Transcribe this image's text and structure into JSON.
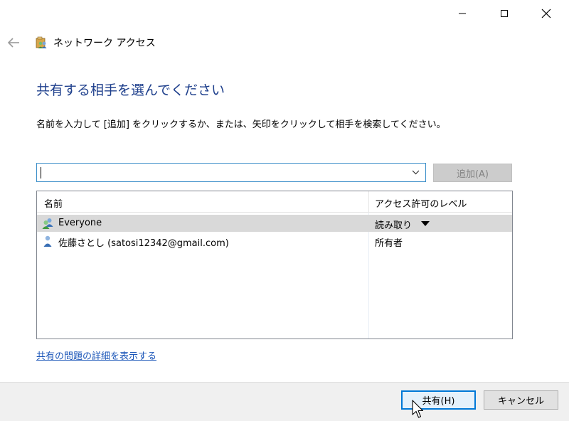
{
  "window": {
    "title": "ネットワーク アクセス",
    "controls": [
      "minimize",
      "maximize",
      "close"
    ]
  },
  "nav": {
    "back_icon": "back-arrow-icon"
  },
  "content": {
    "heading": "共有する相手を選んでください",
    "instruction": "名前を入力して [追加] をクリックするか、または、矢印をクリックして相手を検索してください。",
    "name_input": {
      "value": "",
      "placeholder": ""
    },
    "add_button": "追加(A)"
  },
  "listview": {
    "columns": {
      "name": "名前",
      "level": "アクセス許可のレベル"
    },
    "rows": [
      {
        "name": "Everyone",
        "level": "読み取り",
        "icon": "group-users-icon",
        "selected": true,
        "has_dropdown": true
      },
      {
        "name": "佐藤さとし (satosi12342@gmail.com)",
        "level": "所有者",
        "icon": "user-icon",
        "selected": false,
        "has_dropdown": false
      }
    ]
  },
  "details_link": "共有の問題の詳細を表示する",
  "footer": {
    "share_button": "共有(H)",
    "cancel_button": "キャンセル"
  },
  "colors": {
    "heading": "#1e3f8c",
    "link": "#1a55b8",
    "focus_border": "#0078d7",
    "selected_row": "#d9d9d9",
    "footer_bg": "#f0f0f0"
  }
}
